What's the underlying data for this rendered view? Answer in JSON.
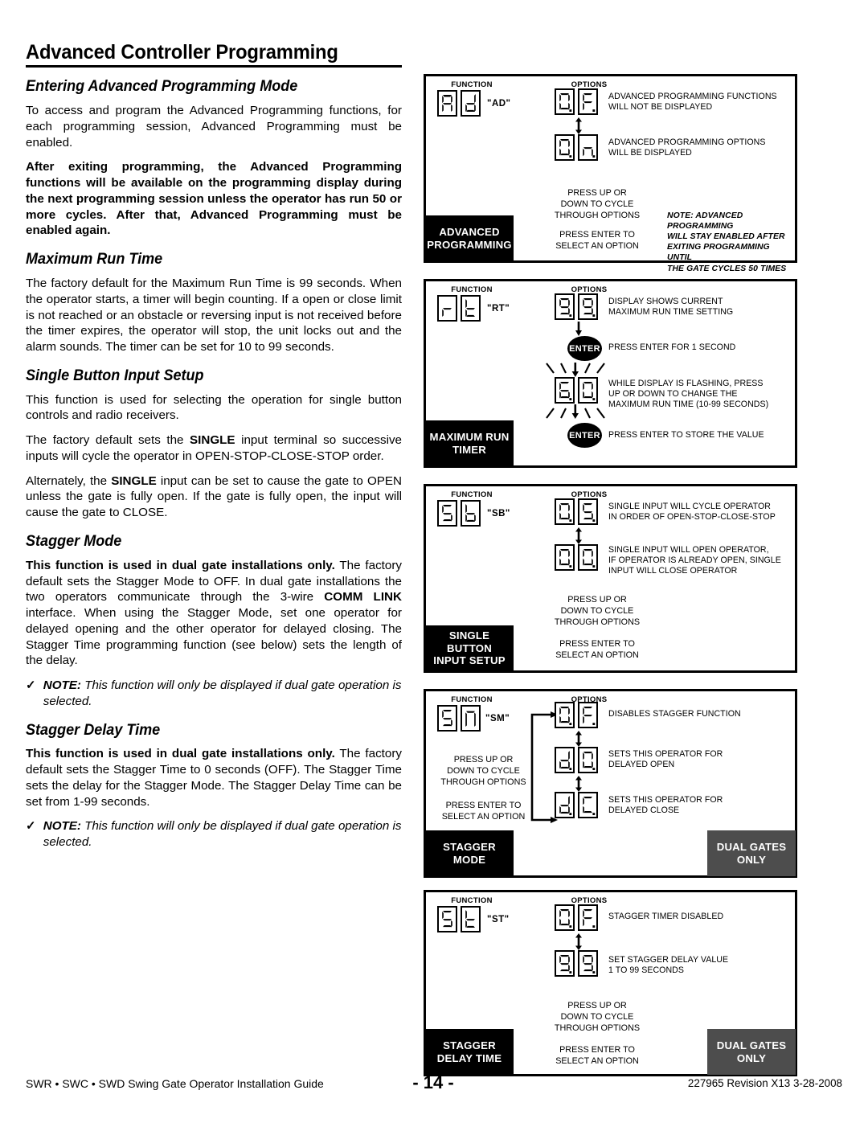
{
  "document": {
    "title": "Advanced Controller Programming",
    "footer": {
      "models": "SWR • SWC • SWD   Swing Gate Operator Installation Guide",
      "page": "- 14 -",
      "revision": "227965 Revision X13 3-28-2008"
    }
  },
  "sections": [
    {
      "heading": "Entering Advanced Programming Mode",
      "p1": "To access and program the Advanced Programming functions, for each programming session, Advanced Programming must be enabled.",
      "p2": "After exiting programming, the Advanced Programming functions will be available on the programming display during the next programming session unless the operator has run 50 or more cycles. After that, Advanced Programming must be enabled again."
    },
    {
      "heading": "Maximum Run Time",
      "p1": "The factory default for the Maximum Run Time is 99 seconds. When the operator starts, a timer will begin counting. If a open or close limit is not reached or an obstacle or reversing input is not received before the timer expires, the operator will stop, the unit locks out and the alarm sounds. The timer can be set for 10 to 99 seconds."
    },
    {
      "heading": "Single Button Input Setup",
      "p1": "This function is used for selecting the operation for single button controls and radio receivers.",
      "p2a": "The factory default sets the ",
      "p2b": "SINGLE",
      "p2c": " input terminal so successive inputs will cycle the operator in OPEN-STOP-CLOSE-STOP order.",
      "p3a": "Alternately, the ",
      "p3b": "SINGLE",
      "p3c": " input can be set to cause the gate to OPEN unless the gate is fully open. If the gate is fully open, the input will cause the gate to CLOSE."
    },
    {
      "heading": "Stagger Mode",
      "p1a": "This function is used in dual gate installations only.",
      "p1b": " The factory default sets the Stagger Mode to OFF. In dual gate installations the two operators communicate through the 3-wire ",
      "p1c": "COMM LINK",
      "p1d": " interface. When using the Stagger Mode, set one operator for delayed opening and the other operator for delayed closing. The Stagger Time programming function (see below) sets the length of the delay.",
      "note_check": "✓",
      "note_label": "NOTE:",
      "note_text": " This function will only be displayed if dual gate operation is selected."
    },
    {
      "heading": "Stagger Delay Time",
      "p1a": "This function is used in dual gate installations only.",
      "p1b": " The factory default sets the Stagger Time to 0 seconds (OFF). The Stagger Time sets the delay for the Stagger Mode. The Stagger Delay Time can be set from 1-99 seconds.",
      "note_check": "✓",
      "note_label": "NOTE:",
      "note_text": " This function will only be displayed if dual gate operation is selected."
    }
  ],
  "diagrams": [
    {
      "id": "advanced-programming",
      "header_function": "FUNCTION",
      "header_options": "OPTIONS",
      "function_digits": [
        "A",
        "d"
      ],
      "function_label": "\"AD\"",
      "options": [
        {
          "digits": [
            "0",
            "F"
          ],
          "desc": "ADVANCED PROGRAMMING FUNCTIONS\nWILL NOT BE DISPLAYED"
        },
        {
          "digits": [
            "0",
            "n"
          ],
          "desc": "ADVANCED PROGRAMMING OPTIONS\nWILL BE DISPLAYED"
        }
      ],
      "instructions": "PRESS UP OR\nDOWN TO CYCLE\nTHROUGH OPTIONS",
      "instructions2": "PRESS ENTER TO\nSELECT AN OPTION",
      "note": "NOTE: ADVANCED PROGRAMMING\nWILL STAY ENABLED AFTER\nEXITING PROGRAMMING UNTIL\nTHE GATE CYCLES 50 TIMES",
      "label": "ADVANCED\nPROGRAMMING"
    },
    {
      "id": "maximum-run-timer",
      "header_function": "FUNCTION",
      "header_options": "OPTIONS",
      "function_digits": [
        "r",
        "t"
      ],
      "function_label": "\"RT\"",
      "options": [
        {
          "digits": [
            "9",
            "9"
          ],
          "desc": "DISPLAY SHOWS CURRENT\nMAXIMUM RUN TIME SETTING"
        },
        {
          "enter": "ENTER",
          "desc": "PRESS ENTER FOR 1 SECOND"
        },
        {
          "digits": [
            "6",
            "0"
          ],
          "flashing": true,
          "desc": "WHILE DISPLAY IS FLASHING, PRESS\nUP OR DOWN TO CHANGE THE\nMAXIMUM RUN TIME (10-99 SECONDS)"
        },
        {
          "enter": "ENTER",
          "desc": "PRESS ENTER TO STORE THE VALUE"
        }
      ],
      "label": "MAXIMUM RUN\nTIMER"
    },
    {
      "id": "single-button-input-setup",
      "header_function": "FUNCTION",
      "header_options": "OPTIONS",
      "function_digits": [
        "5",
        "b"
      ],
      "function_label": "\"SB\"",
      "options": [
        {
          "digits": [
            "0",
            "5"
          ],
          "desc": "SINGLE INPUT WILL CYCLE OPERATOR\nIN ORDER OF OPEN-STOP-CLOSE-STOP"
        },
        {
          "digits": [
            "0",
            "0"
          ],
          "desc": "SINGLE INPUT WILL OPEN OPERATOR,\nIF OPERATOR IS ALREADY OPEN, SINGLE\nINPUT WILL CLOSE OPERATOR"
        }
      ],
      "instructions": "PRESS UP OR\nDOWN TO CYCLE\nTHROUGH OPTIONS",
      "instructions2": "PRESS ENTER TO\nSELECT AN OPTION",
      "label": "SINGLE BUTTON\nINPUT SETUP"
    },
    {
      "id": "stagger-mode",
      "header_function": "FUNCTION",
      "header_options": "OPTIONS",
      "function_digits": [
        "5",
        "n"
      ],
      "function_label": "\"SM\"",
      "options": [
        {
          "digits": [
            "0",
            "F"
          ],
          "desc": "DISABLES STAGGER FUNCTION"
        },
        {
          "digits": [
            "d",
            "0"
          ],
          "desc": "SETS THIS OPERATOR FOR\nDELAYED OPEN"
        },
        {
          "digits": [
            "d",
            "C"
          ],
          "desc": "SETS THIS OPERATOR FOR\nDELAYED CLOSE"
        }
      ],
      "instructions": "PRESS UP OR\nDOWN TO CYCLE\nTHROUGH OPTIONS",
      "instructions2": "PRESS ENTER TO\nSELECT AN OPTION",
      "label": "STAGGER\nMODE",
      "badge": "DUAL GATES\nONLY"
    },
    {
      "id": "stagger-delay-time",
      "header_function": "FUNCTION",
      "header_options": "OPTIONS",
      "function_digits": [
        "5",
        "t"
      ],
      "function_label": "\"ST\"",
      "options": [
        {
          "digits": [
            "0",
            "F"
          ],
          "desc": "STAGGER TIMER DISABLED"
        },
        {
          "digits": [
            "9",
            "9"
          ],
          "desc": "SET STAGGER DELAY VALUE\n1 TO 99 SECONDS"
        }
      ],
      "instructions": "PRESS UP OR\nDOWN TO CYCLE\nTHROUGH OPTIONS",
      "instructions2": "PRESS ENTER TO\nSELECT AN OPTION",
      "label": "STAGGER\nDELAY TIME",
      "badge": "DUAL GATES\nONLY"
    }
  ],
  "colors": {
    "ink": "#000000",
    "badge_gray": "#4d4d4d",
    "paper": "#ffffff"
  }
}
